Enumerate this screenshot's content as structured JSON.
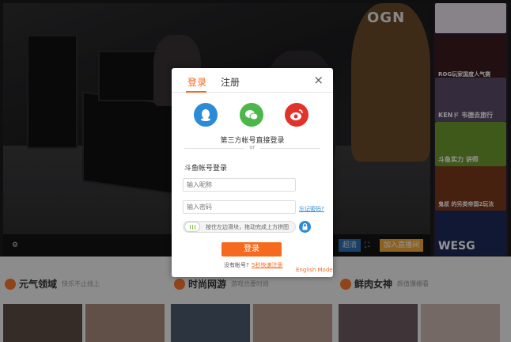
{
  "background": {
    "video_logo": "OGN",
    "video_buttons": {
      "quality": "超清",
      "join": "加入直播间"
    },
    "side_thumbs": [
      {
        "caption": "",
        "color": "#e8e2ec"
      },
      {
        "caption": "ROG玩家国度人气赛",
        "color": "#3a1b1e"
      },
      {
        "caption": "KENド 韦德去旅行",
        "color": "#5a4b6a"
      },
      {
        "caption": "斗鱼实力 讲师",
        "color": "#6d9a2e"
      },
      {
        "caption": "鬼叔 的另类帝国2玩法",
        "color": "#7a3a1c"
      },
      {
        "caption": "WESG",
        "color": "#1d2a58"
      }
    ],
    "sections": [
      {
        "title": "元气领域",
        "sub": "快乐不止线上"
      },
      {
        "title": "时尚网游",
        "sub": "游戏也要时尚"
      },
      {
        "title": "鲜肉女神",
        "sub": "颜值爆棚看"
      }
    ]
  },
  "modal": {
    "tabs": {
      "login": "登录",
      "register": "注册"
    },
    "close": "×",
    "social": [
      {
        "name": "qq",
        "color": "#2b8bd6"
      },
      {
        "name": "wechat",
        "color": "#4cb74a"
      },
      {
        "name": "weibo",
        "color": "#e0332a"
      }
    ],
    "third_party": "第三方帐号直接登录",
    "or": "or",
    "account_title": "斗鱼帐号登录",
    "nickname_placeholder": "输入昵称",
    "password_placeholder": "输入密码",
    "forgot": "忘记密码?",
    "slider_text": "按住左边滑块，拖动完成上方拼图",
    "login_button": "登录",
    "no_account": "没有帐号?",
    "register_link": "5秒快速注册",
    "english_mode": "English Mode"
  }
}
